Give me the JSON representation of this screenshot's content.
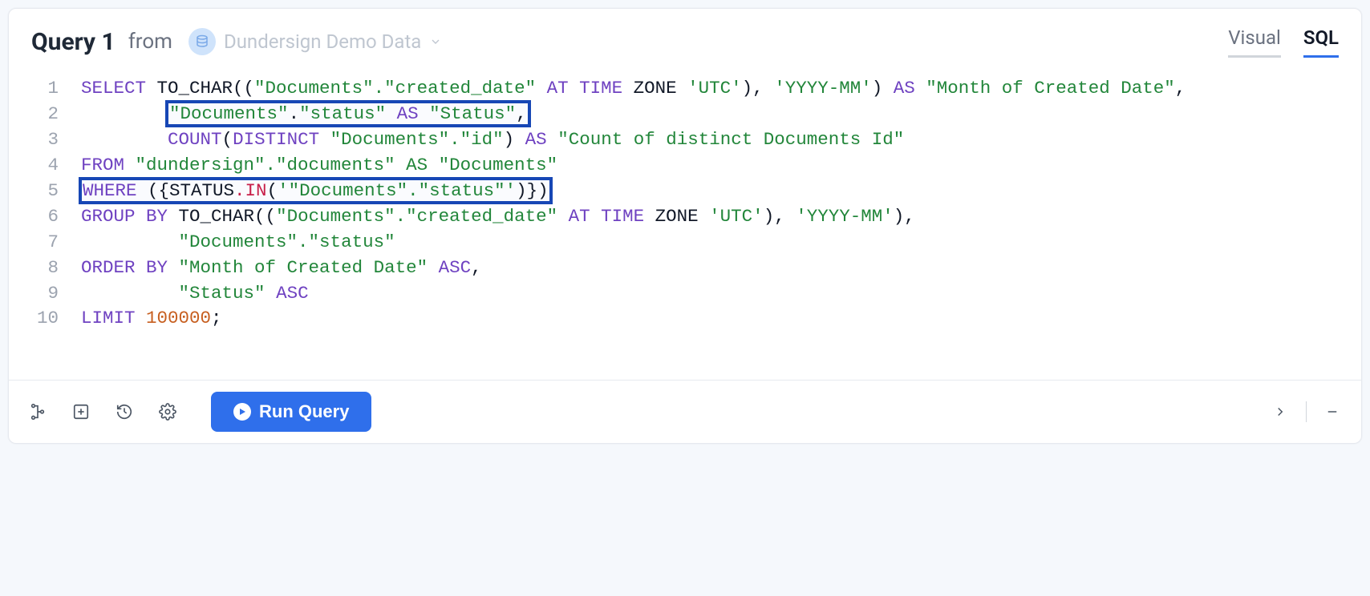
{
  "header": {
    "title": "Query 1",
    "from_label": "from",
    "datasource": "Dundersign Demo Data"
  },
  "tabs": {
    "visual": "Visual",
    "sql": "SQL",
    "active": "sql"
  },
  "code": {
    "l1_select": "SELECT",
    "l1_tochar": " TO_CHAR((",
    "l1_doc_created": "\"Documents\".\"created_date\"",
    "l1_at": " AT",
    "l1_time": " TIME",
    "l1_zone": " ZONE ",
    "l1_utc": "'UTC'",
    "l1_close_fmt": "), ",
    "l1_fmt": "'YYYY-MM'",
    "l1_close2": ")",
    "l1_as": " AS ",
    "l1_alias": "\"Month of Created Date\"",
    "l1_comma": ",",
    "indent8": "        ",
    "l2_box": "\"Documents\".\"status\" AS \"Status\",",
    "l3_count": "COUNT",
    "l3_paren": "(",
    "l3_distinct": "DISTINCT",
    "l3_sp": " ",
    "l3_docid": "\"Documents\".\"id\"",
    "l3_close": ")",
    "l3_as": " AS ",
    "l3_alias": "\"Count of distinct Documents Id\"",
    "l4_from": "FROM",
    "l4_tbl": " \"dundersign\".\"documents\" AS \"Documents\"",
    "l5_box": "WHERE ({STATUS.IN('\"Documents\".\"status\"')})",
    "l6_groupby": "GROUP BY",
    "l6_rest_a": " TO_CHAR((",
    "l6_doc_created": "\"Documents\".\"created_date\"",
    "l6_at": " AT",
    "l6_time": " TIME",
    "l6_zone": " ZONE ",
    "l6_utc": "'UTC'",
    "l6_close_fmt": "), ",
    "l6_fmt": "'YYYY-MM'",
    "l6_close2": "),",
    "indent9": "         ",
    "l7_val": "\"Documents\".\"status\"",
    "l8_orderby": "ORDER BY",
    "l8_val": " \"Month of Created Date\"",
    "l8_asc": " ASC",
    "l8_comma": ",",
    "l9_val": "\"Status\"",
    "l9_asc": " ASC",
    "l10_limit": "LIMIT ",
    "l10_num": "100000",
    "l10_semi": ";"
  },
  "footer": {
    "run_label": "Run Query"
  },
  "gutters": [
    "1",
    "2",
    "3",
    "4",
    "5",
    "6",
    "7",
    "8",
    "9",
    "10"
  ]
}
